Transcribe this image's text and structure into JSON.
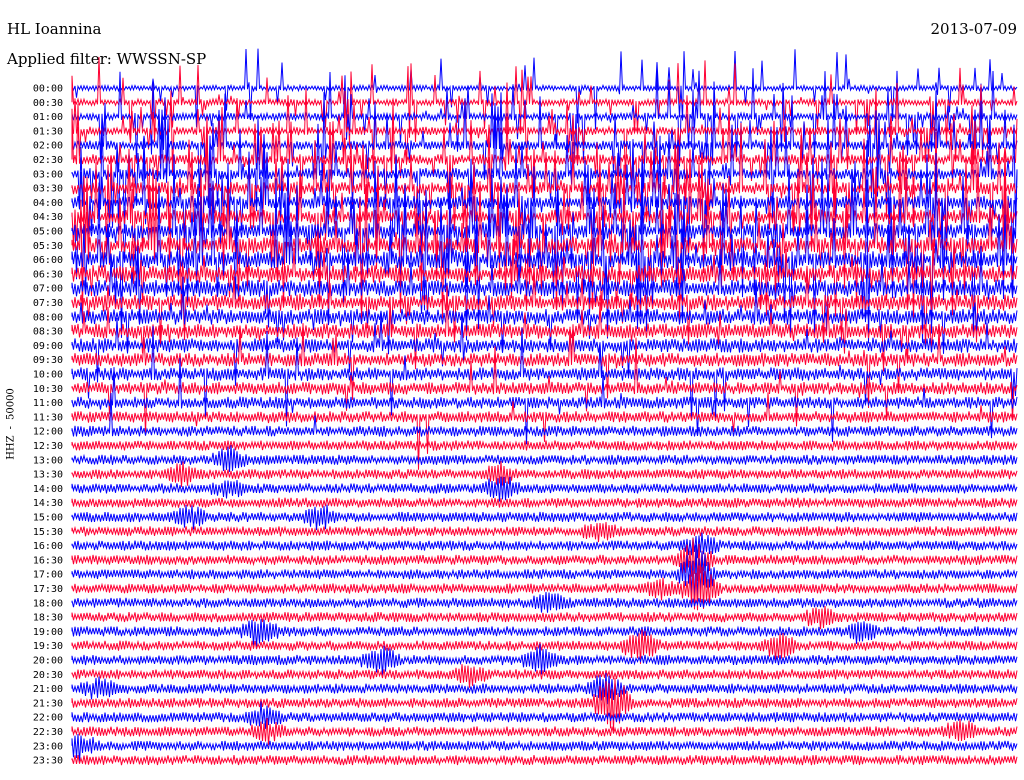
{
  "header": {
    "station": "HL Ioannina",
    "filter": "Applied filter: WWSSN-SP",
    "date": "2013-07-09"
  },
  "channel": {
    "component": "HHZ",
    "separator": "-",
    "scale": "50000"
  },
  "colors": {
    "trace_a": "#0000ff",
    "trace_b": "#ff0033",
    "background": "#ffffff"
  },
  "chart_data": {
    "type": "line",
    "title": "",
    "xlabel": "",
    "ylabel": "HHZ - 50000",
    "row_interval_minutes": 30,
    "grid": false,
    "legend": "none",
    "row_labels": [
      "00:00",
      "00:30",
      "01:00",
      "01:30",
      "02:00",
      "02:30",
      "03:00",
      "03:30",
      "04:00",
      "04:30",
      "05:00",
      "05:30",
      "06:00",
      "06:30",
      "07:00",
      "07:30",
      "08:00",
      "08:30",
      "09:00",
      "09:30",
      "10:00",
      "10:30",
      "11:00",
      "11:30",
      "12:00",
      "12:30",
      "13:00",
      "13:30",
      "14:00",
      "14:30",
      "15:00",
      "15:30",
      "16:00",
      "16:30",
      "17:00",
      "17:30",
      "18:00",
      "18:30",
      "19:00",
      "19:30",
      "20:00",
      "20:30",
      "21:00",
      "21:30",
      "22:00",
      "22:30",
      "23:00",
      "23:30"
    ],
    "series": [
      {
        "color": "blue",
        "rows": "00:00, 01:00, 02:00, ... (even rows)"
      },
      {
        "color": "red",
        "rows": "00:30, 01:30, 02:30, ... (odd rows)"
      }
    ]
  }
}
